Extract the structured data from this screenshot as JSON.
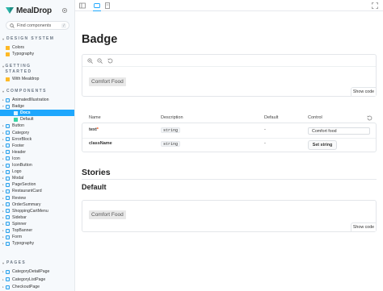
{
  "brand": {
    "name": "MealDrop",
    "accent": "#1ea7fd",
    "logo_color": "#2bb4a8"
  },
  "search": {
    "placeholder": "Find components",
    "shortcut": "/"
  },
  "sidebar": {
    "sections": {
      "design_system": "DESIGN SYSTEM",
      "getting_started": "GETTING STARTED",
      "components": "COMPONENTS",
      "pages": "PAGES"
    },
    "design_system_items": [
      "Colors",
      "Typography"
    ],
    "getting_started_items": [
      "With Mealdrop"
    ],
    "components_items": [
      "AnimatedIllustration",
      "Badge",
      "Docs",
      "Default",
      "Button",
      "Category",
      "ErrorBlock",
      "Footer",
      "Header",
      "Icon",
      "IconButton",
      "Logo",
      "Modal",
      "PageSection",
      "RestaurantCard",
      "Review",
      "OrderSummary",
      "ShoppingCartMenu",
      "Sidebar",
      "Spinner",
      "TopBanner",
      "Form",
      "Typography"
    ],
    "pages_items": [
      "CategoryDetailPage",
      "CategoryListPage",
      "CheckoutPage"
    ]
  },
  "toolbar": {
    "icons": [
      "sidebar-toggle-icon",
      "canvas-icon",
      "docs-icon",
      "fullscreen-icon"
    ]
  },
  "main": {
    "title": "Badge",
    "preview": {
      "badge_text": "Comfort Food",
      "show_code": "Show code"
    },
    "args_table": {
      "headers": {
        "name": "Name",
        "description": "Description",
        "default": "Default",
        "control": "Control"
      },
      "rows": [
        {
          "name": "text",
          "required": "*",
          "type": "string",
          "default": "-",
          "control_value": "Comfort food"
        },
        {
          "name": "className",
          "type": "string",
          "default": "-",
          "control_button": "Set string"
        }
      ]
    },
    "stories_heading": "Stories",
    "story_name": "Default",
    "story": {
      "badge_text": "Comfort Food",
      "show_code": "Show code"
    }
  }
}
